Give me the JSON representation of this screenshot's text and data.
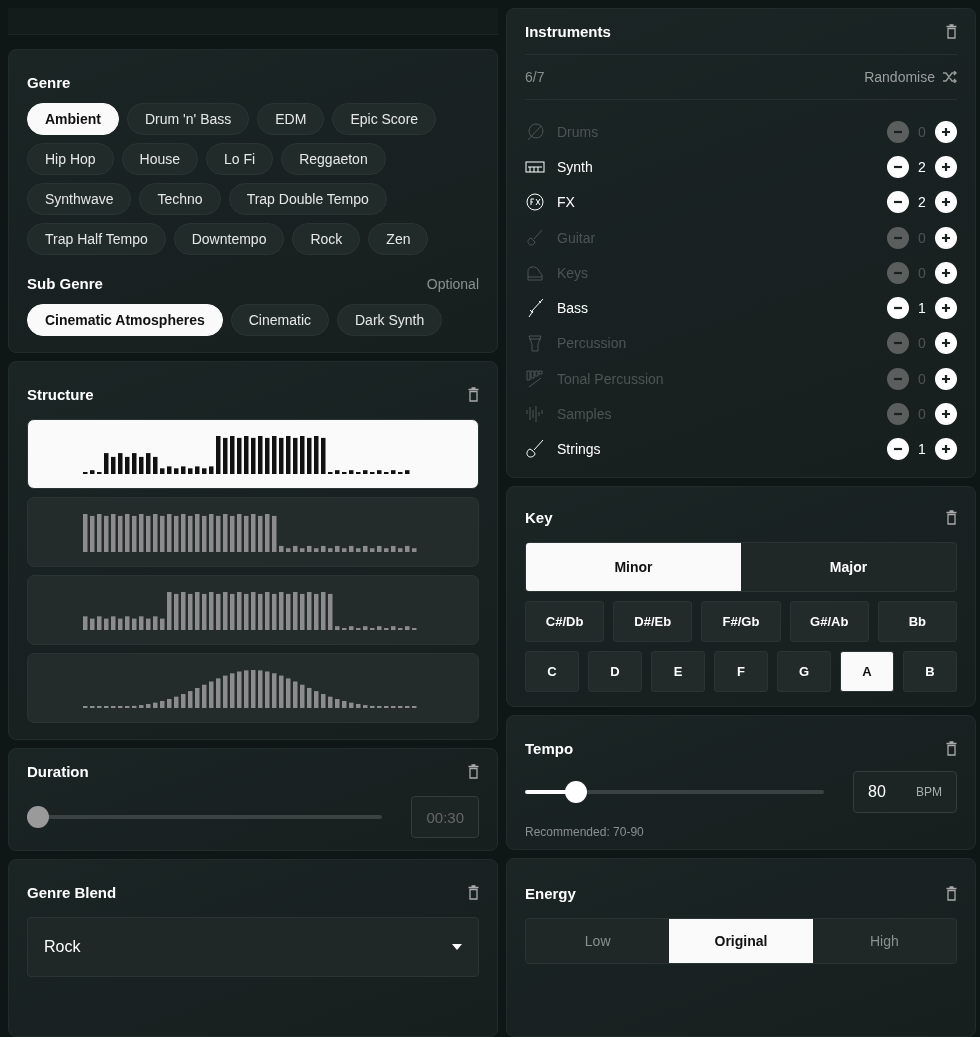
{
  "genre": {
    "title": "Genre",
    "options": [
      {
        "label": "Ambient",
        "selected": true
      },
      {
        "label": "Drum 'n' Bass",
        "selected": false
      },
      {
        "label": "EDM",
        "selected": false
      },
      {
        "label": "Epic Score",
        "selected": false
      },
      {
        "label": "Hip Hop",
        "selected": false
      },
      {
        "label": "House",
        "selected": false
      },
      {
        "label": "Lo Fi",
        "selected": false
      },
      {
        "label": "Reggaeton",
        "selected": false
      },
      {
        "label": "Synthwave",
        "selected": false
      },
      {
        "label": "Techno",
        "selected": false
      },
      {
        "label": "Trap Double Tempo",
        "selected": false
      },
      {
        "label": "Trap Half Tempo",
        "selected": false
      },
      {
        "label": "Downtempo",
        "selected": false
      },
      {
        "label": "Rock",
        "selected": false
      },
      {
        "label": "Zen",
        "selected": false
      }
    ]
  },
  "sub_genre": {
    "title": "Sub Genre",
    "note": "Optional",
    "options": [
      {
        "label": "Cinematic Atmospheres",
        "selected": true
      },
      {
        "label": "Cinematic",
        "selected": false
      },
      {
        "label": "Dark Synth",
        "selected": false
      }
    ]
  },
  "structure": {
    "title": "Structure",
    "options": [
      {
        "kind": "build",
        "selected": true
      },
      {
        "kind": "front",
        "selected": false
      },
      {
        "kind": "rise",
        "selected": false
      },
      {
        "kind": "peak",
        "selected": false
      }
    ]
  },
  "duration": {
    "title": "Duration",
    "level": 0,
    "value": "00:30"
  },
  "genre_blend": {
    "title": "Genre Blend",
    "value": "Rock"
  },
  "instruments": {
    "title": "Instruments",
    "count": "6/7",
    "randomise": "Randomise",
    "items": [
      {
        "name": "Drums",
        "count": "0",
        "active": false
      },
      {
        "name": "Synth",
        "count": "2",
        "active": true
      },
      {
        "name": "FX",
        "count": "2",
        "active": true
      },
      {
        "name": "Guitar",
        "count": "0",
        "active": false
      },
      {
        "name": "Keys",
        "count": "0",
        "active": false
      },
      {
        "name": "Bass",
        "count": "1",
        "active": true
      },
      {
        "name": "Percussion",
        "count": "0",
        "active": false
      },
      {
        "name": "Tonal Percussion",
        "count": "0",
        "active": false
      },
      {
        "name": "Samples",
        "count": "0",
        "active": false
      },
      {
        "name": "Strings",
        "count": "1",
        "active": true
      }
    ]
  },
  "key": {
    "title": "Key",
    "modes": [
      {
        "label": "Minor",
        "selected": true
      },
      {
        "label": "Major",
        "selected": false
      }
    ],
    "sharps": [
      {
        "label": "C#/Db",
        "selected": false
      },
      {
        "label": "D#/Eb",
        "selected": false
      },
      {
        "label": "F#/Gb",
        "selected": false
      },
      {
        "label": "G#/Ab",
        "selected": false
      },
      {
        "label": "Bb",
        "selected": false
      }
    ],
    "naturals": [
      {
        "label": "C",
        "selected": false
      },
      {
        "label": "D",
        "selected": false
      },
      {
        "label": "E",
        "selected": false
      },
      {
        "label": "F",
        "selected": false
      },
      {
        "label": "G",
        "selected": false
      },
      {
        "label": "A",
        "selected": true
      },
      {
        "label": "B",
        "selected": false
      }
    ]
  },
  "tempo": {
    "title": "Tempo",
    "level": 0.14,
    "value": "80",
    "unit": "BPM",
    "hint": "Recommended: 70-90"
  },
  "energy": {
    "title": "Energy",
    "options": [
      {
        "label": "Low",
        "selected": false
      },
      {
        "label": "Original",
        "selected": true
      },
      {
        "label": "High",
        "selected": false
      }
    ]
  }
}
